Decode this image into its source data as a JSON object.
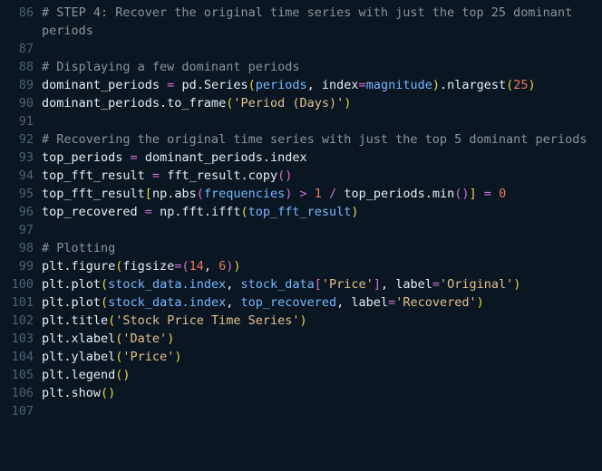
{
  "editor": {
    "name": "python-code-editor",
    "language": "python",
    "theme": {
      "background": "#0a1622",
      "foreground": "#e6edf3",
      "line_number": "#4e6077",
      "comment": "#8b949e",
      "variable": "#79b8ff",
      "string": "#e3c08d",
      "number": "#f0785a",
      "operator": "#d072d0",
      "bracket_yellow": "#e8d44d",
      "bracket_magenta": "#d072d0",
      "bracket_blue": "#79b8ff"
    },
    "first_line_number": 86,
    "last_line_number": 107,
    "lines": [
      {
        "number": "86",
        "tokens": [
          {
            "text": "# STEP 4: Recover the original time series with just the top 25 dominant periods",
            "cls": "t-comment"
          }
        ]
      },
      {
        "number": "87",
        "tokens": []
      },
      {
        "number": "88",
        "tokens": [
          {
            "text": "# Displaying a few dominant periods",
            "cls": "t-comment"
          }
        ]
      },
      {
        "number": "89",
        "tokens": [
          {
            "text": "dominant_periods ",
            "cls": "t-plain"
          },
          {
            "text": "=",
            "cls": "t-op"
          },
          {
            "text": " pd.Series",
            "cls": "t-plain"
          },
          {
            "text": "(",
            "cls": "t-br-y"
          },
          {
            "text": "periods",
            "cls": "t-var"
          },
          {
            "text": ", ",
            "cls": "t-plain"
          },
          {
            "text": "index",
            "cls": "t-plain"
          },
          {
            "text": "=",
            "cls": "t-op"
          },
          {
            "text": "magnitude",
            "cls": "t-var"
          },
          {
            "text": ")",
            "cls": "t-br-y"
          },
          {
            "text": ".nlargest",
            "cls": "t-plain"
          },
          {
            "text": "(",
            "cls": "t-br-y"
          },
          {
            "text": "25",
            "cls": "t-number"
          },
          {
            "text": ")",
            "cls": "t-br-y"
          }
        ]
      },
      {
        "number": "90",
        "tokens": [
          {
            "text": "dominant_periods.to_frame",
            "cls": "t-plain"
          },
          {
            "text": "(",
            "cls": "t-br-y"
          },
          {
            "text": "'Period (Days)'",
            "cls": "t-string"
          },
          {
            "text": ")",
            "cls": "t-br-y"
          }
        ]
      },
      {
        "number": "91",
        "tokens": []
      },
      {
        "number": "92",
        "tokens": [
          {
            "text": "# Recovering the original time series with just the top 5 dominant periods",
            "cls": "t-comment"
          }
        ]
      },
      {
        "number": "93",
        "tokens": [
          {
            "text": "top_periods ",
            "cls": "t-plain"
          },
          {
            "text": "=",
            "cls": "t-op"
          },
          {
            "text": " dominant_periods.index",
            "cls": "t-plain"
          }
        ]
      },
      {
        "number": "94",
        "tokens": [
          {
            "text": "top_fft_result ",
            "cls": "t-plain"
          },
          {
            "text": "=",
            "cls": "t-op"
          },
          {
            "text": " fft_result.copy",
            "cls": "t-plain"
          },
          {
            "text": "()",
            "cls": "t-br-m"
          }
        ]
      },
      {
        "number": "95",
        "tokens": [
          {
            "text": "top_fft_result",
            "cls": "t-plain"
          },
          {
            "text": "[",
            "cls": "t-br-y"
          },
          {
            "text": "np.abs",
            "cls": "t-plain"
          },
          {
            "text": "(",
            "cls": "t-br-m"
          },
          {
            "text": "frequencies",
            "cls": "t-var"
          },
          {
            "text": ")",
            "cls": "t-br-m"
          },
          {
            "text": " > ",
            "cls": "t-op"
          },
          {
            "text": "1",
            "cls": "t-number"
          },
          {
            "text": " / ",
            "cls": "t-op"
          },
          {
            "text": "top_periods.min",
            "cls": "t-plain"
          },
          {
            "text": "()",
            "cls": "t-br-m"
          },
          {
            "text": "]",
            "cls": "t-br-y"
          },
          {
            "text": " ",
            "cls": "t-plain"
          },
          {
            "text": "=",
            "cls": "t-op"
          },
          {
            "text": " ",
            "cls": "t-plain"
          },
          {
            "text": "0",
            "cls": "t-number"
          }
        ]
      },
      {
        "number": "96",
        "tokens": [
          {
            "text": "top_recovered ",
            "cls": "t-plain"
          },
          {
            "text": "=",
            "cls": "t-op"
          },
          {
            "text": " np.fft.ifft",
            "cls": "t-plain"
          },
          {
            "text": "(",
            "cls": "t-br-y"
          },
          {
            "text": "top_fft_result",
            "cls": "t-var"
          },
          {
            "text": ")",
            "cls": "t-br-y"
          }
        ]
      },
      {
        "number": "97",
        "tokens": []
      },
      {
        "number": "98",
        "tokens": [
          {
            "text": "# Plotting",
            "cls": "t-comment"
          }
        ]
      },
      {
        "number": "99",
        "tokens": [
          {
            "text": "plt.figure",
            "cls": "t-plain"
          },
          {
            "text": "(",
            "cls": "t-br-y"
          },
          {
            "text": "figsize",
            "cls": "t-plain"
          },
          {
            "text": "=",
            "cls": "t-op"
          },
          {
            "text": "(",
            "cls": "t-br-m"
          },
          {
            "text": "14",
            "cls": "t-number"
          },
          {
            "text": ", ",
            "cls": "t-plain"
          },
          {
            "text": "6",
            "cls": "t-number"
          },
          {
            "text": ")",
            "cls": "t-br-m"
          },
          {
            "text": ")",
            "cls": "t-br-y"
          }
        ]
      },
      {
        "number": "100",
        "tokens": [
          {
            "text": "plt.plot",
            "cls": "t-plain"
          },
          {
            "text": "(",
            "cls": "t-br-y"
          },
          {
            "text": "stock_data.index",
            "cls": "t-var"
          },
          {
            "text": ", ",
            "cls": "t-plain"
          },
          {
            "text": "stock_data",
            "cls": "t-var"
          },
          {
            "text": "[",
            "cls": "t-br-m"
          },
          {
            "text": "'Price'",
            "cls": "t-string"
          },
          {
            "text": "]",
            "cls": "t-br-m"
          },
          {
            "text": ", ",
            "cls": "t-plain"
          },
          {
            "text": "label",
            "cls": "t-plain"
          },
          {
            "text": "=",
            "cls": "t-op"
          },
          {
            "text": "'Original'",
            "cls": "t-string"
          },
          {
            "text": ")",
            "cls": "t-br-y"
          }
        ]
      },
      {
        "number": "101",
        "tokens": [
          {
            "text": "plt.plot",
            "cls": "t-plain"
          },
          {
            "text": "(",
            "cls": "t-br-y"
          },
          {
            "text": "stock_data.index",
            "cls": "t-var"
          },
          {
            "text": ", ",
            "cls": "t-plain"
          },
          {
            "text": "top_recovered",
            "cls": "t-var"
          },
          {
            "text": ", ",
            "cls": "t-plain"
          },
          {
            "text": "label",
            "cls": "t-plain"
          },
          {
            "text": "=",
            "cls": "t-op"
          },
          {
            "text": "'Recovered'",
            "cls": "t-string"
          },
          {
            "text": ")",
            "cls": "t-br-y"
          }
        ]
      },
      {
        "number": "102",
        "tokens": [
          {
            "text": "plt.title",
            "cls": "t-plain"
          },
          {
            "text": "(",
            "cls": "t-br-y"
          },
          {
            "text": "'Stock Price Time Series'",
            "cls": "t-string"
          },
          {
            "text": ")",
            "cls": "t-br-y"
          }
        ]
      },
      {
        "number": "103",
        "tokens": [
          {
            "text": "plt.xlabel",
            "cls": "t-plain"
          },
          {
            "text": "(",
            "cls": "t-br-y"
          },
          {
            "text": "'Date'",
            "cls": "t-string"
          },
          {
            "text": ")",
            "cls": "t-br-y"
          }
        ]
      },
      {
        "number": "104",
        "tokens": [
          {
            "text": "plt.ylabel",
            "cls": "t-plain"
          },
          {
            "text": "(",
            "cls": "t-br-y"
          },
          {
            "text": "'Price'",
            "cls": "t-string"
          },
          {
            "text": ")",
            "cls": "t-br-y"
          }
        ]
      },
      {
        "number": "105",
        "tokens": [
          {
            "text": "plt.legend",
            "cls": "t-plain"
          },
          {
            "text": "()",
            "cls": "t-br-y"
          }
        ]
      },
      {
        "number": "106",
        "tokens": [
          {
            "text": "plt.show",
            "cls": "t-plain"
          },
          {
            "text": "()",
            "cls": "t-br-y"
          }
        ]
      },
      {
        "number": "107",
        "tokens": []
      }
    ]
  }
}
